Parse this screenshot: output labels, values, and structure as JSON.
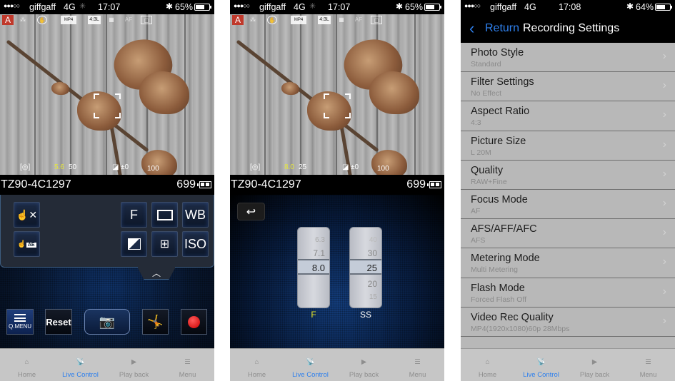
{
  "screens": [
    {
      "status": {
        "signal": "●●●○○",
        "carrier": "giffgaff",
        "network": "4G",
        "time": "17:07",
        "battery": "65%",
        "battery_level": 0.65
      },
      "osd": {
        "mode": "A",
        "aperture": "5.6",
        "shutter": "50",
        "exposure": "±0",
        "iso": "100"
      },
      "camera": {
        "name": "TZ90-4C1297",
        "shots_remaining": "699"
      },
      "controls": {
        "touch_shutter_cancel": "touch-shutter-off",
        "touch_ae": "AE",
        "aperture_btn": "F",
        "aspect_btn": "aspect",
        "wb_btn": "WB",
        "exposure_btn": "exposure-comp",
        "metering_btn": "af-area",
        "iso_btn": "ISO",
        "expand": "^"
      },
      "bottom": {
        "qmenu": "Q.MENU",
        "reset": "Reset",
        "shutter": "camera",
        "scene": "creative",
        "record": "rec"
      }
    },
    {
      "status": {
        "signal": "●●●○○",
        "carrier": "giffgaff",
        "network": "4G",
        "time": "17:07",
        "battery": "65%",
        "battery_level": 0.65
      },
      "osd": {
        "mode": "A",
        "aperture": "8.0",
        "shutter": "25",
        "exposure": "±0",
        "iso": "100"
      },
      "camera": {
        "name": "TZ90-4C1297",
        "shots_remaining": "699"
      },
      "aperture_drum": {
        "label": "F",
        "values": [
          "6.3",
          "7.1",
          "8.0",
          "",
          ""
        ],
        "selected": "8.0",
        "label_color": "#e8e82a"
      },
      "shutter_drum": {
        "label": "SS",
        "values": [
          "40",
          "30",
          "25",
          "20",
          "15"
        ],
        "selected": "25",
        "label_color": "#ffffff"
      }
    },
    {
      "status": {
        "signal": "●●●○○",
        "carrier": "giffgaff",
        "network": "4G",
        "time": "17:08",
        "battery": "64%",
        "battery_level": 0.64
      },
      "nav": {
        "back": "Return",
        "title": "Recording Settings"
      },
      "settings": [
        {
          "name": "Photo Style",
          "value": "Standard"
        },
        {
          "name": "Filter Settings",
          "value": "No Effect"
        },
        {
          "name": "Aspect Ratio",
          "value": "4:3"
        },
        {
          "name": "Picture Size",
          "value": "L 20M"
        },
        {
          "name": "Quality",
          "value": "RAW+Fine"
        },
        {
          "name": "Focus Mode",
          "value": "AF"
        },
        {
          "name": "AFS/AFF/AFC",
          "value": "AFS"
        },
        {
          "name": "Metering Mode",
          "value": "Multi Metering"
        },
        {
          "name": "Flash Mode",
          "value": "Forced Flash Off"
        },
        {
          "name": "Video Rec Quality",
          "value": "MP4(1920x1080)60p 28Mbps"
        }
      ]
    }
  ],
  "tabbar": {
    "items": [
      {
        "label": "Home",
        "icon": "home-icon"
      },
      {
        "label": "Live Control",
        "icon": "remote-icon",
        "active": true
      },
      {
        "label": "Play back",
        "icon": "play-icon"
      },
      {
        "label": "Menu",
        "icon": "menu-icon"
      }
    ],
    "active_color": "#2f80ed",
    "inactive_color": "#8e8e8e"
  }
}
